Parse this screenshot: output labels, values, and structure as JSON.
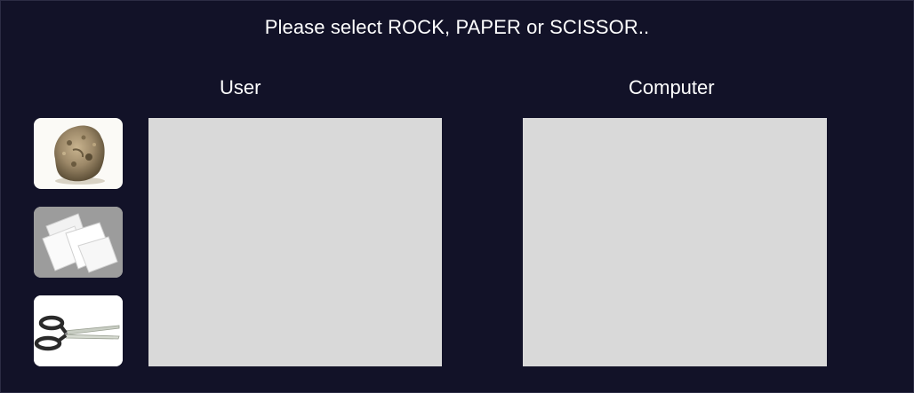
{
  "prompt": "Please select ROCK, PAPER or SCISSOR..",
  "labels": {
    "user": "User",
    "computer": "Computer"
  },
  "choices": [
    {
      "id": "rock",
      "icon": "rock-icon"
    },
    {
      "id": "paper",
      "icon": "paper-icon"
    },
    {
      "id": "scissor",
      "icon": "scissors-icon"
    }
  ],
  "colors": {
    "background": "#121228",
    "panel": "#d9d9d9",
    "text": "#ffffff"
  }
}
